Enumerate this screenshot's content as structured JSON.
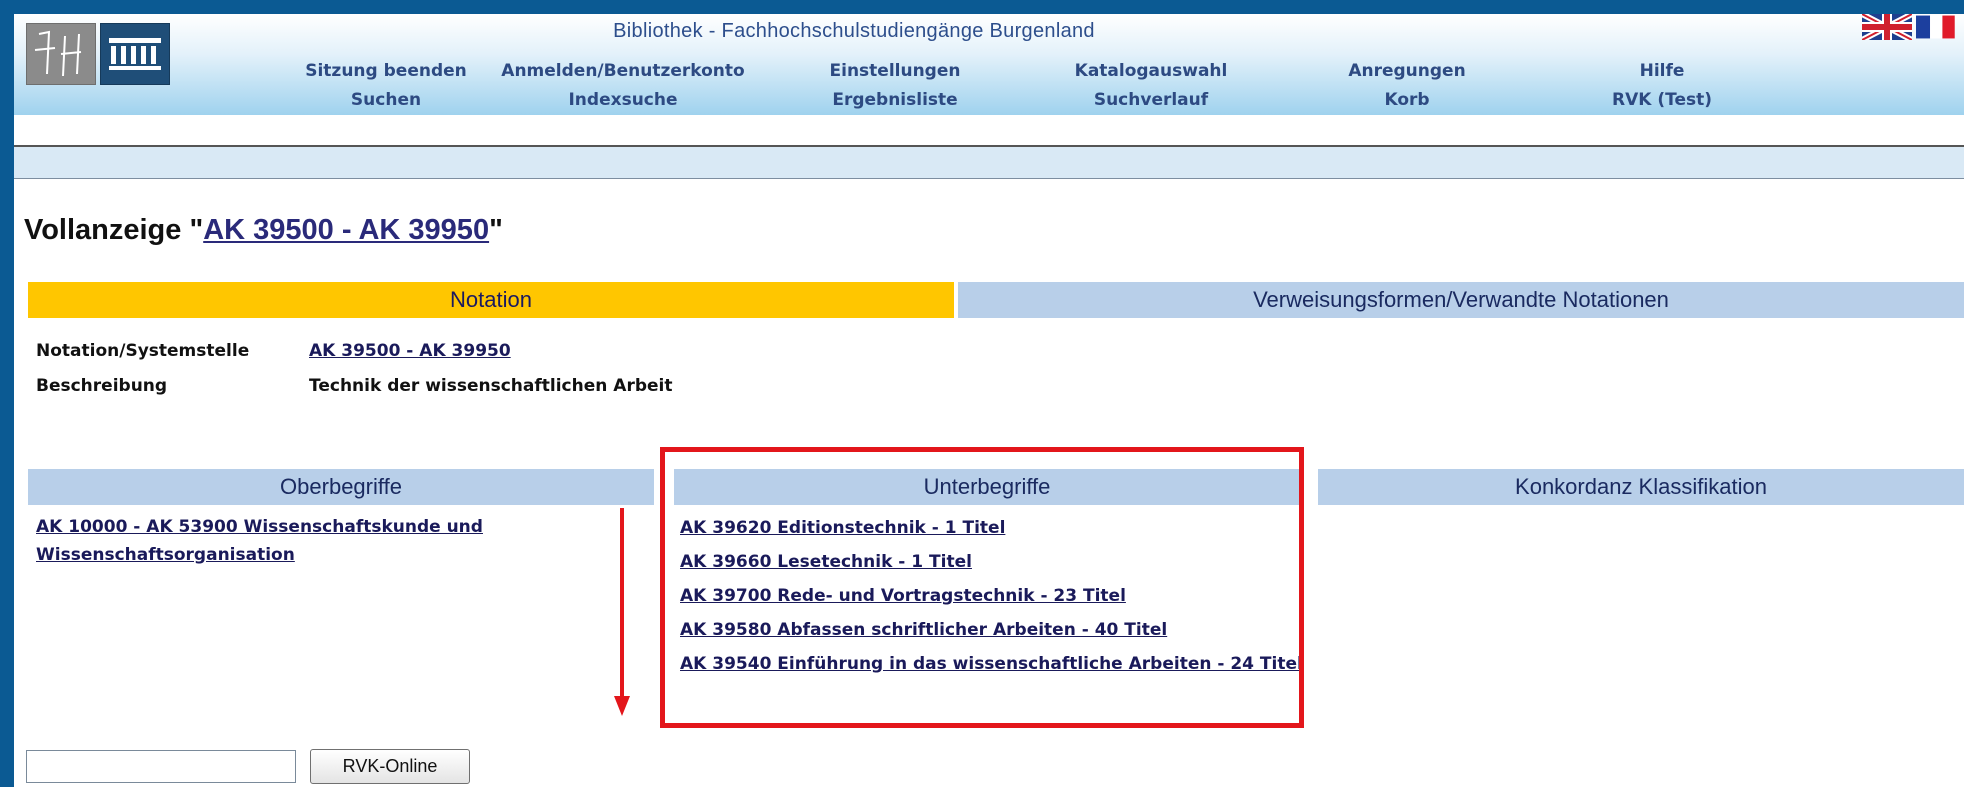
{
  "header": {
    "site_title": "Bibliothek - Fachhochschulstudiengänge Burgenland",
    "logos": [
      "fh-logo-icon",
      "library-building-icon"
    ],
    "flags": [
      "uk-flag-icon",
      "france-flag-icon"
    ]
  },
  "nav": {
    "row1": [
      "Sitzung beenden",
      "Anmelden/Benutzerkonto",
      "Einstellungen",
      "Katalogauswahl",
      "Anregungen",
      "Hilfe"
    ],
    "row2": [
      "Suchen",
      "Indexsuche",
      "Ergebnisliste",
      "Suchverlauf",
      "Korb",
      "RVK (Test)"
    ]
  },
  "page": {
    "title_prefix": "Vollanzeige \"",
    "title_link": "AK 39500 - AK 39950",
    "title_suffix": "\""
  },
  "tabs": {
    "notation": "Notation",
    "verweisung": "Verweisungsformen/Verwandte Notationen"
  },
  "fields": {
    "notation_label": "Notation/Systemstelle",
    "notation_value": "AK 39500 - AK 39950",
    "beschreibung_label": "Beschreibung",
    "beschreibung_value": "Technik der wissenschaftlichen Arbeit"
  },
  "columns": {
    "ober_header": "Oberbegriffe",
    "unter_header": "Unterbegriffe",
    "konkordanz_header": "Konkordanz Klassifikation"
  },
  "oberbegriffe": [
    "AK 10000 - AK 53900 Wissenschaftskunde und Wissenschaftsorganisation"
  ],
  "unterbegriffe": [
    "AK 39620 Editionstechnik - 1 Titel",
    "AK 39660 Lesetechnik - 1 Titel",
    "AK 39700 Rede- und Vortragstechnik - 23 Titel",
    "AK 39580 Abfassen schriftlicher Arbeiten - 40 Titel",
    "AK 39540 Einführung in das wissenschaftliche Arbeiten - 24 Titel"
  ],
  "footer": {
    "search_value": "",
    "button_label": "RVK-Online"
  },
  "colors": {
    "background_frame": "#0b5a93",
    "notation_tab": "#ffc600",
    "header_tab": "#b8cfe9",
    "highlight": "#e3161b",
    "link": "#1a1a5a"
  }
}
